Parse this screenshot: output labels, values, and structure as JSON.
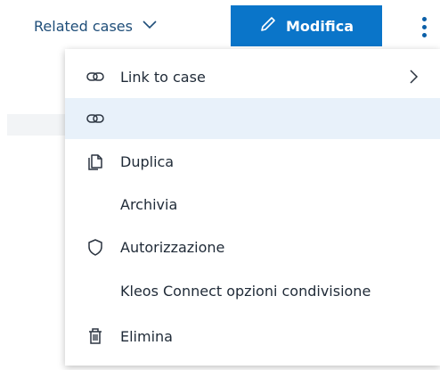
{
  "toolbar": {
    "related_cases_label": "Related cases",
    "related_cases_icon": "chevron-down-icon",
    "edit_label": "Modifica",
    "edit_icon": "pencil-icon",
    "more_icon": "kebab-menu-icon",
    "accent_color": "#0a75c9"
  },
  "menu": {
    "items": [
      {
        "label": "Link to case",
        "icon": "link-icon",
        "has_submenu": true,
        "active": false
      },
      {
        "label": "",
        "icon": "link-icon",
        "has_submenu": false,
        "active": true
      },
      {
        "label": "Duplica",
        "icon": "duplicate-icon",
        "has_submenu": false,
        "active": false
      },
      {
        "label": "Archivia",
        "icon": "",
        "has_submenu": false,
        "active": false
      },
      {
        "label": "Autorizzazione",
        "icon": "shield-icon",
        "has_submenu": false,
        "active": false
      },
      {
        "label": "Kleos Connect opzioni condivisione",
        "icon": "",
        "has_submenu": false,
        "active": false
      },
      {
        "label": "Elimina",
        "icon": "trash-icon",
        "has_submenu": false,
        "active": false
      }
    ]
  }
}
